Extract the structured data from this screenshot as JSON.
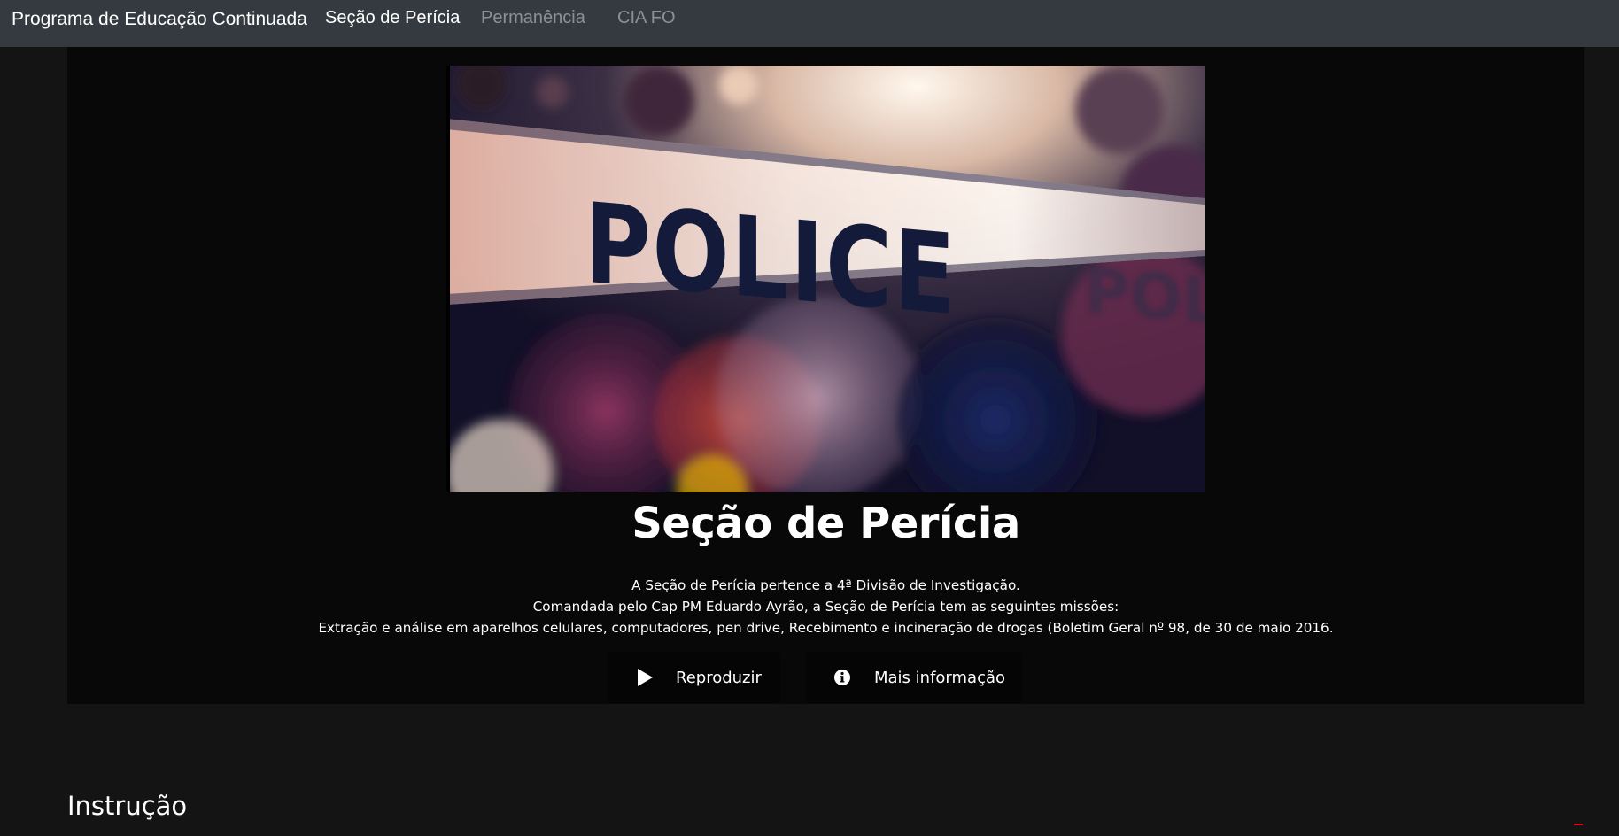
{
  "navbar": {
    "brand": "Programa de Educação Continuada",
    "links": [
      {
        "label": "Seção de Perícia",
        "active": true
      },
      {
        "label": "Permanência",
        "active": false
      },
      {
        "label": "CIA FO",
        "active": false
      }
    ]
  },
  "hero": {
    "image_icon": "police-tape-image",
    "title": "Seção de Perícia",
    "description": [
      "A Seção de Perícia pertence a 4ª Divisão de Investigação.",
      "Comandada pelo Cap PM Eduardo Ayrão, a Seção de Perícia tem as seguintes missões:",
      "Extração e análise em aparelhos celulares, computadores, pen drive, Recebimento e incineração de drogas (Boletim Geral nº 98, de 30 de maio 2016."
    ],
    "buttons": {
      "play": {
        "label": "Reproduzir",
        "icon": "play-icon"
      },
      "info": {
        "label": "Mais informação",
        "icon": "info-circle-icon"
      }
    }
  },
  "sections": {
    "first_heading": "Instrução"
  },
  "colors": {
    "navbar_bg": "#343a40",
    "page_bg": "#141414",
    "hero_bg": "#080808",
    "accent": "#e50914"
  }
}
